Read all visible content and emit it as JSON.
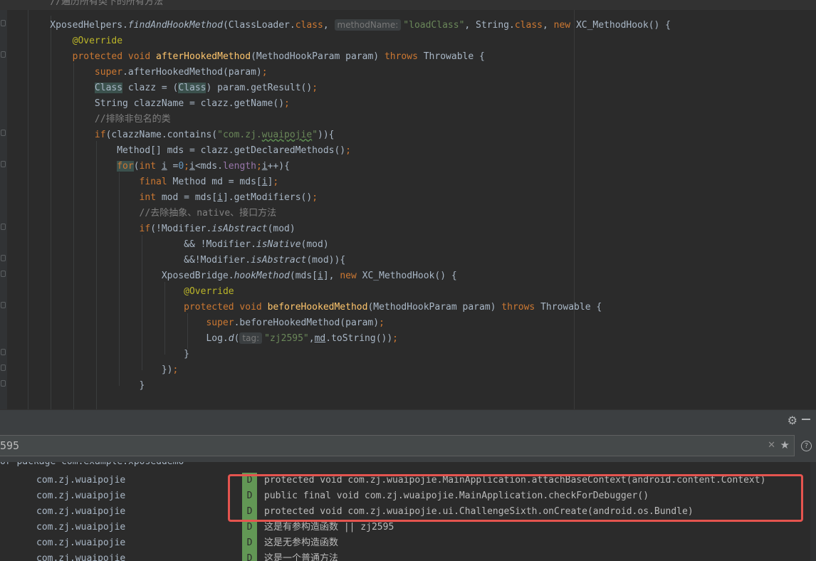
{
  "editor": {
    "lines": [
      [
        {
          "t": "    "
        },
        {
          "t": "//遍历所有类下的所有方法",
          "c": "cmt"
        }
      ],
      [
        {
          "t": "    XposedHelpers."
        },
        {
          "t": "findAndHookMethod",
          "c": "ital"
        },
        {
          "t": "(ClassLoader."
        },
        {
          "t": "class",
          "c": "kw"
        },
        {
          "t": ", "
        },
        {
          "t": "methodName:",
          "c": "hint"
        },
        {
          "t": "\"loadClass\"",
          "c": "str"
        },
        {
          "t": ", String."
        },
        {
          "t": "class",
          "c": "kw"
        },
        {
          "t": ", "
        },
        {
          "t": "new",
          "c": "kw"
        },
        {
          "t": " XC_MethodHook() {"
        }
      ],
      [
        {
          "t": "        "
        },
        {
          "t": "@Override",
          "c": "ann"
        }
      ],
      [
        {
          "t": "        "
        },
        {
          "t": "protected void ",
          "c": "kw"
        },
        {
          "t": "afterHookedMethod",
          "c": "mth"
        },
        {
          "t": "(MethodHookParam param) "
        },
        {
          "t": "throws",
          "c": "kw"
        },
        {
          "t": " Throwable {"
        }
      ],
      [
        {
          "t": "            "
        },
        {
          "t": "super",
          "c": "kw"
        },
        {
          "t": ".afterHookedMethod(param)"
        },
        {
          "t": ";",
          "c": "kw"
        }
      ],
      [
        {
          "t": "            "
        },
        {
          "t": "Class",
          "c": "hl"
        },
        {
          "t": " clazz = ("
        },
        {
          "t": "Class",
          "c": "hl"
        },
        {
          "t": ") param.getResult()"
        },
        {
          "t": ";",
          "c": "kw"
        }
      ],
      [
        {
          "t": "            String clazzName = clazz.getName()"
        },
        {
          "t": ";",
          "c": "kw"
        }
      ],
      [
        {
          "t": "            "
        },
        {
          "t": "//排除非包名的类",
          "c": "cmt"
        }
      ],
      [
        {
          "t": "            "
        },
        {
          "t": "if",
          "c": "kw"
        },
        {
          "t": "(clazzName.contains("
        },
        {
          "t": "\"com.zj.",
          "c": "str"
        },
        {
          "t": "wuaipojie",
          "c": "str wavy"
        },
        {
          "t": "\"",
          "c": "str"
        },
        {
          "t": ")){"
        }
      ],
      [
        {
          "t": "                Method[] mds = clazz.getDeclaredMethods()"
        },
        {
          "t": ";",
          "c": "kw"
        }
      ],
      [
        {
          "t": "                "
        },
        {
          "t": "for",
          "c": "kw hl"
        },
        {
          "t": "("
        },
        {
          "t": "int ",
          "c": "kw"
        },
        {
          "t": "i",
          "c": "ul"
        },
        {
          "t": " ="
        },
        {
          "t": "0",
          "c": "num"
        },
        {
          "t": ";",
          "c": "kw"
        },
        {
          "t": "i",
          "c": "ul"
        },
        {
          "t": "<mds."
        },
        {
          "t": "length",
          "c": "fld"
        },
        {
          "t": ";",
          "c": "kw"
        },
        {
          "t": "i",
          "c": "ul"
        },
        {
          "t": "++){"
        }
      ],
      [
        {
          "t": "                    "
        },
        {
          "t": "final ",
          "c": "kw"
        },
        {
          "t": "Method md = mds["
        },
        {
          "t": "i",
          "c": "ul"
        },
        {
          "t": "]"
        },
        {
          "t": ";",
          "c": "kw"
        }
      ],
      [
        {
          "t": "                    "
        },
        {
          "t": "int ",
          "c": "kw"
        },
        {
          "t": "mod = mds["
        },
        {
          "t": "i",
          "c": "ul"
        },
        {
          "t": "].getModifiers()"
        },
        {
          "t": ";",
          "c": "kw"
        }
      ],
      [
        {
          "t": "                    "
        },
        {
          "t": "//去除抽象、native、接口方法",
          "c": "cmt"
        }
      ],
      [
        {
          "t": "                    "
        },
        {
          "t": "if",
          "c": "kw"
        },
        {
          "t": "(!Modifier."
        },
        {
          "t": "isAbstract",
          "c": "ital"
        },
        {
          "t": "(mod)"
        }
      ],
      [
        {
          "t": "                            && !Modifier."
        },
        {
          "t": "isNative",
          "c": "ital"
        },
        {
          "t": "(mod)"
        }
      ],
      [
        {
          "t": "                            &&!Modifier."
        },
        {
          "t": "isAbstract",
          "c": "ital"
        },
        {
          "t": "(mod)){"
        }
      ],
      [
        {
          "t": "                        XposedBridge."
        },
        {
          "t": "hookMethod",
          "c": "ital"
        },
        {
          "t": "(mds["
        },
        {
          "t": "i",
          "c": "ul"
        },
        {
          "t": "], "
        },
        {
          "t": "new",
          "c": "kw"
        },
        {
          "t": " XC_MethodHook() {"
        }
      ],
      [
        {
          "t": "                            "
        },
        {
          "t": "@Override",
          "c": "ann"
        }
      ],
      [
        {
          "t": "                            "
        },
        {
          "t": "protected void ",
          "c": "kw"
        },
        {
          "t": "beforeHookedMethod",
          "c": "mth"
        },
        {
          "t": "(MethodHookParam param) "
        },
        {
          "t": "throws",
          "c": "kw"
        },
        {
          "t": " Throwable {"
        }
      ],
      [
        {
          "t": "                                "
        },
        {
          "t": "super",
          "c": "kw"
        },
        {
          "t": ".beforeHookedMethod(param)"
        },
        {
          "t": ";",
          "c": "kw"
        }
      ],
      [
        {
          "t": "                                Log."
        },
        {
          "t": "d",
          "c": "ital"
        },
        {
          "t": "("
        },
        {
          "t": "tag:",
          "c": "hint"
        },
        {
          "t": "\"zj2595\"",
          "c": "str"
        },
        {
          "t": ","
        },
        {
          "t": "md",
          "c": "ul"
        },
        {
          "t": ".toString())"
        },
        {
          "t": ";",
          "c": "kw"
        }
      ],
      [
        {
          "t": "                            }"
        }
      ],
      [
        {
          "t": "                        })"
        },
        {
          "t": ";",
          "c": "kw"
        }
      ],
      [
        {
          "t": "                    }"
        }
      ]
    ]
  },
  "panel": {
    "filter_value": "595"
  },
  "log": {
    "clipped_line": "or package com.example.xposeddemo",
    "rows": [
      {
        "tag": "com.zj.wuaipojie",
        "level": "D",
        "message": "protected void com.zj.wuaipojie.MainApplication.attachBaseContext(android.content.Context)"
      },
      {
        "tag": "com.zj.wuaipojie",
        "level": "D",
        "message": "public final void com.zj.wuaipojie.MainApplication.checkForDebugger()"
      },
      {
        "tag": "com.zj.wuaipojie",
        "level": "D",
        "message": "protected void com.zj.wuaipojie.ui.ChallengeSixth.onCreate(android.os.Bundle)"
      },
      {
        "tag": "com.zj.wuaipojie",
        "level": "D",
        "message": "这是有参构造函数 || zj2595"
      },
      {
        "tag": "com.zj.wuaipojie",
        "level": "D",
        "message": "这是无参构造函数"
      },
      {
        "tag": "com.zj.wuaipojie",
        "level": "D",
        "message": "这是一个普通方法"
      }
    ]
  },
  "colors": {
    "keyword": "#cc7832",
    "string": "#6a8759",
    "comment": "#808080",
    "annotation": "#bbb529",
    "method": "#ffc66d",
    "log_debug": "#629755",
    "highlight_box": "#e5544f"
  }
}
